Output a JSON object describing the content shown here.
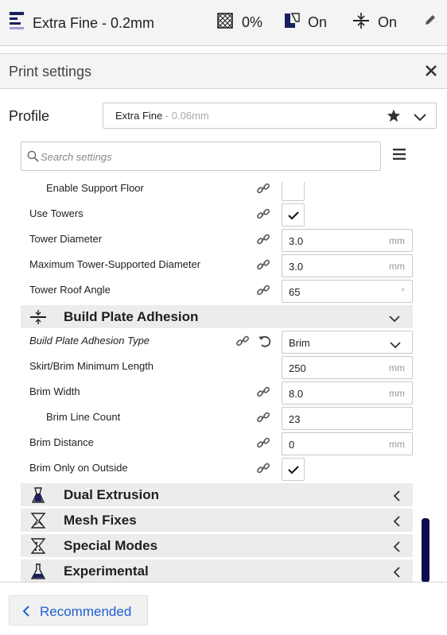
{
  "header": {
    "profile_title": "Extra Fine - 0.2mm",
    "infill_value": "0%",
    "support_value": "On",
    "adhesion_value": "On"
  },
  "panel": {
    "title": "Print settings",
    "profile_label": "Profile",
    "profile_name": "Extra Fine",
    "profile_sub": " - 0.06mm",
    "search_placeholder": "Search settings"
  },
  "settings": {
    "enable_support_floor": "Enable Support Floor",
    "use_towers": "Use Towers",
    "tower_diameter": {
      "label": "Tower Diameter",
      "value": "3.0",
      "unit": "mm"
    },
    "max_tower_supported": {
      "label": "Maximum Tower-Supported Diameter",
      "value": "3.0",
      "unit": "mm"
    },
    "tower_roof_angle": {
      "label": "Tower Roof Angle",
      "value": "65",
      "unit": "°"
    },
    "category_adhesion": "Build Plate Adhesion",
    "adhesion_type": {
      "label": "Build Plate Adhesion Type",
      "value": "Brim"
    },
    "skirt_brim_min_length": {
      "label": "Skirt/Brim Minimum Length",
      "value": "250",
      "unit": "mm"
    },
    "brim_width": {
      "label": "Brim Width",
      "value": "8.0",
      "unit": "mm"
    },
    "brim_line_count": {
      "label": "Brim Line Count",
      "value": "23"
    },
    "brim_distance": {
      "label": "Brim Distance",
      "value": "0",
      "unit": "mm"
    },
    "brim_only_outside": "Brim Only on Outside",
    "category_dual_extrusion": "Dual Extrusion",
    "category_mesh_fixes": "Mesh Fixes",
    "category_special_modes": "Special Modes",
    "category_experimental": "Experimental"
  },
  "footer": {
    "recommended_label": "Recommended"
  },
  "colors": {
    "accent_blue": "#1d5fd0",
    "scrollbar": "#0b0e4c",
    "category_bg": "#ececec"
  }
}
